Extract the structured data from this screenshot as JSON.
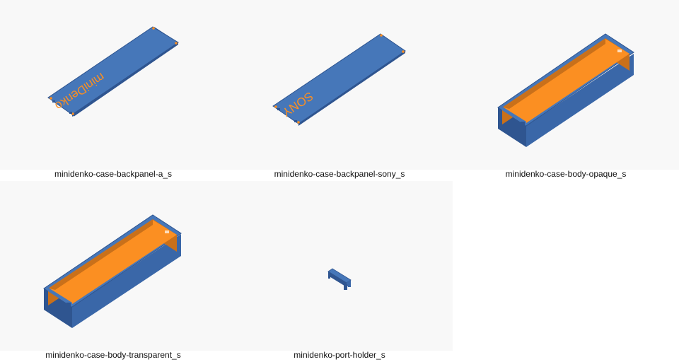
{
  "colors": {
    "panel_blue": "#4677b9",
    "panel_blue_dark": "#2f5590",
    "interior_orange": "#fb8f22",
    "interior_orange_dark": "#c9701a",
    "background": "#f8f8f8"
  },
  "models": [
    {
      "caption": "minidenko-case-backpanel-a_s",
      "engraving": "miniDenko"
    },
    {
      "caption": "minidenko-case-backpanel-sony_s",
      "engraving": "SONY"
    },
    {
      "caption": "minidenko-case-body-opaque_s"
    },
    {
      "caption": "minidenko-case-body-transparent_s"
    },
    {
      "caption": "minidenko-port-holder_s"
    }
  ]
}
